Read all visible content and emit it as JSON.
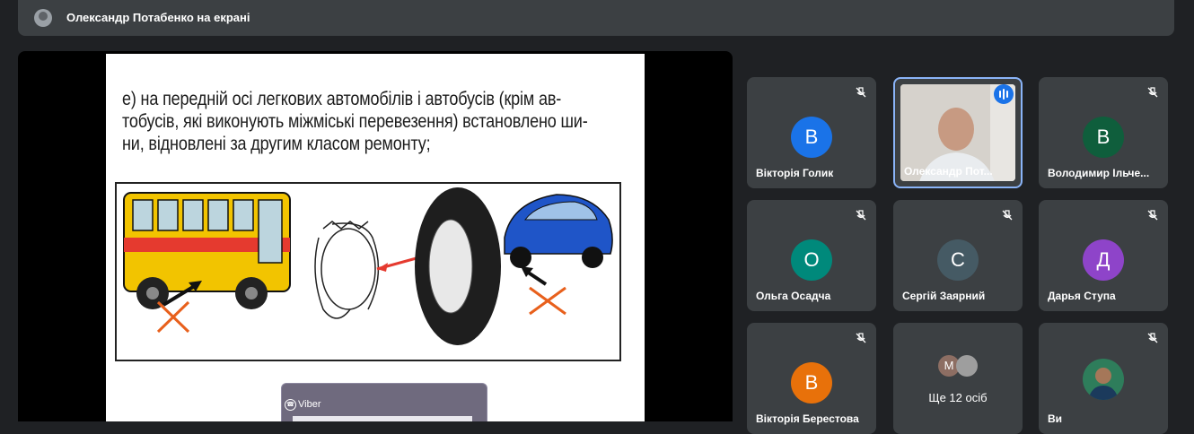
{
  "top_bar": {
    "presenter_label": "Олександр Потабенко на екрані"
  },
  "presentation": {
    "text": "е) на передній осі легкових автомобілів і автобусів (крім автобусів, які виконують міжміські перевезення) встановлено шини, відновлені за другим класом ремонту;",
    "line1": "е) на передній осі легкових автомобілів і автобусів (крім ав-",
    "line2": "тобусів, які виконують міжміські перевезення) встановлено ши-",
    "line3": "ни, відновлені за другим класом ремонту;"
  },
  "overlay_window": {
    "app_name": "Viber"
  },
  "participants": [
    {
      "name": "Вікторія Голик",
      "initial": "В",
      "color": "#1a73e8",
      "muted": true
    },
    {
      "name": "Олександр Пот...",
      "video": true,
      "speaking": true
    },
    {
      "name": "Володимир Ільче...",
      "initial": "В",
      "color": "#0f5e3c",
      "muted": true
    },
    {
      "name": "Ольга Осадча",
      "initial": "О",
      "color": "#00897b",
      "muted": true
    },
    {
      "name": "Сергій Заярний",
      "initial": "С",
      "color": "#455a64",
      "muted": true
    },
    {
      "name": "Дарья Ступа",
      "initial": "Д",
      "color": "#8e44c9",
      "muted": true
    },
    {
      "name": "Вікторія Берестова",
      "initial": "В",
      "color": "#e8710a",
      "muted": true
    },
    {
      "more_label": "Ще 12 осіб",
      "initial": "М"
    },
    {
      "name": "Ви",
      "muted": true
    }
  ],
  "icons": {
    "mic_off": "mic-off-icon",
    "speaking": "audio-level-icon",
    "viber": "viber-icon"
  }
}
